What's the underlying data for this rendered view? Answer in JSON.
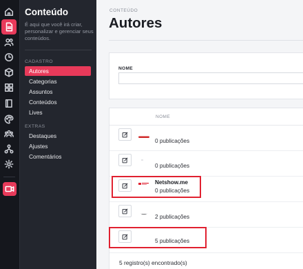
{
  "rail": {
    "items": [
      {
        "icon": "home-icon"
      },
      {
        "icon": "document-icon",
        "active": true
      },
      {
        "icon": "users-icon"
      },
      {
        "icon": "clock-icon"
      },
      {
        "icon": "box-icon"
      },
      {
        "icon": "grid-icon"
      },
      {
        "icon": "book-icon"
      },
      {
        "icon": "palette-icon"
      },
      {
        "icon": "team-icon"
      },
      {
        "icon": "hierarchy-icon"
      },
      {
        "icon": "gear-icon"
      },
      {
        "icon": "live-video-icon",
        "live": true
      }
    ],
    "accent": "#e83a5a"
  },
  "sidebar": {
    "title": "Conteúdo",
    "description": "É aqui que você irá criar, personalizar e gerenciar seus conteúdos.",
    "sections": [
      {
        "label": "CADASTRO",
        "items": [
          {
            "label": "Autores",
            "active": true
          },
          {
            "label": "Categorias"
          },
          {
            "label": "Assuntos"
          },
          {
            "label": "Conteúdos"
          },
          {
            "label": "Lives"
          }
        ]
      },
      {
        "label": "EXTRAS",
        "items": [
          {
            "label": "Destaques"
          },
          {
            "label": "Ajustes"
          },
          {
            "label": "Comentários"
          }
        ]
      }
    ]
  },
  "main": {
    "breadcrumb": "CONTEÚDO",
    "title": "Autores",
    "filter": {
      "label": "NOME",
      "value": "",
      "placeholder": ""
    },
    "table": {
      "column_name": "NOME",
      "rows": [
        {
          "name": "",
          "count": "0 publicações",
          "thumb": "red-logo"
        },
        {
          "name": "",
          "count": "0 publicações",
          "thumb": "dash"
        },
        {
          "name": "Netshow.me",
          "count": "0 publicações",
          "thumb": "netshow-logo",
          "highlighted": true
        },
        {
          "name": "",
          "count": "2 publicações",
          "thumb": "dark-logo"
        },
        {
          "name": "",
          "count": "5 publicações",
          "thumb": "none",
          "highlighted": true
        }
      ],
      "footer": "5 registro(s) encontrado(s)"
    },
    "highlight_color": "#e0202f"
  }
}
